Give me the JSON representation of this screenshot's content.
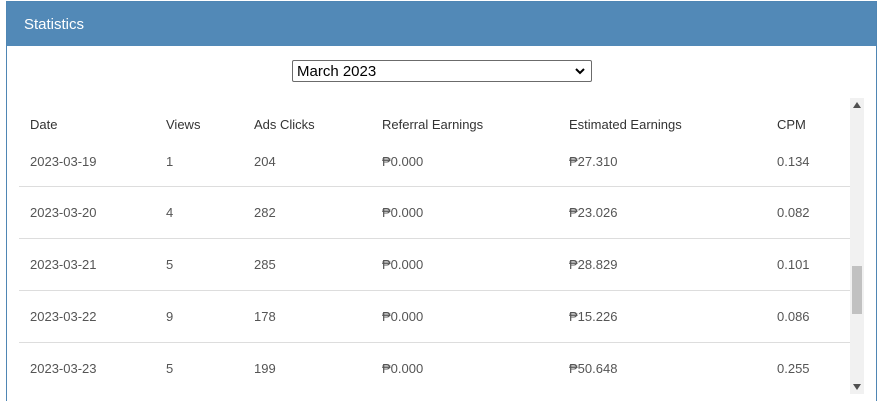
{
  "panel": {
    "title": "Statistics"
  },
  "month_select": {
    "value": "March 2023"
  },
  "table": {
    "headers": [
      "Date",
      "Views",
      "Ads Clicks",
      "Referral Earnings",
      "Estimated Earnings",
      "CPM"
    ],
    "rows": [
      [
        "2023-03-19",
        "1",
        "204",
        "₱0.000",
        "₱27.310",
        "0.134"
      ],
      [
        "2023-03-20",
        "4",
        "282",
        "₱0.000",
        "₱23.026",
        "0.082"
      ],
      [
        "2023-03-21",
        "5",
        "285",
        "₱0.000",
        "₱28.829",
        "0.101"
      ],
      [
        "2023-03-22",
        "9",
        "178",
        "₱0.000",
        "₱15.226",
        "0.086"
      ],
      [
        "2023-03-23",
        "5",
        "199",
        "₱0.000",
        "₱50.648",
        "0.255"
      ]
    ]
  },
  "colors": {
    "header_bg": "#5289b7",
    "header_text": "#ffffff",
    "row_divider": "#dddddd"
  },
  "icons": {
    "select_caret": "chevron-down-icon",
    "scroll_up": "triangle-up-icon",
    "scroll_down": "triangle-down-icon"
  }
}
